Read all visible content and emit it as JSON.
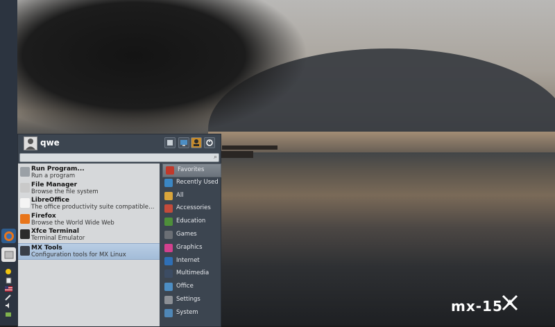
{
  "desktop": {
    "logo_text": "mx-15"
  },
  "left_panel": {
    "apps": [
      {
        "icon": "firefox-icon"
      },
      {
        "icon": "file-manager-icon"
      }
    ],
    "tray": [
      {
        "icon": "updater-icon"
      },
      {
        "icon": "clipboard-icon"
      },
      {
        "icon": "us-flag-icon"
      },
      {
        "icon": "pen-icon"
      },
      {
        "icon": "volume-icon"
      },
      {
        "icon": "network-icon"
      }
    ]
  },
  "menu": {
    "username": "qwe",
    "header_buttons": [
      {
        "icon": "settings-manager-icon"
      },
      {
        "icon": "lock-screen-icon"
      },
      {
        "icon": "switch-user-icon"
      },
      {
        "icon": "logout-icon"
      }
    ],
    "search": {
      "value": "",
      "placeholder": ""
    },
    "apps": [
      {
        "name": "Run Program...",
        "description": "Run a program",
        "icon": "run-icon",
        "color": "#9aa0a6"
      },
      {
        "name": "File Manager",
        "description": "Browse the file system",
        "icon": "file-manager-icon",
        "color": "#c9c9c9"
      },
      {
        "name": "LibreOffice",
        "description": "The office productivity suite compatible to the o...",
        "icon": "libreoffice-icon",
        "color": "#f4f4f4"
      },
      {
        "name": "Firefox",
        "description": "Browse the World Wide Web",
        "icon": "firefox-icon",
        "color": "#e8751a"
      },
      {
        "name": "Xfce Terminal",
        "description": "Terminal Emulator",
        "icon": "terminal-icon",
        "color": "#2b2b2b"
      },
      {
        "name": "MX Tools",
        "description": "Configuration tools for MX Linux",
        "icon": "mx-tools-icon",
        "color": "#3a3f47",
        "selected": true
      }
    ],
    "categories": [
      {
        "label": "Favorites",
        "icon": "favorites-icon",
        "color": "#c0392b",
        "selected": true
      },
      {
        "label": "Recently Used",
        "icon": "recently-used-icon",
        "color": "#3b87c4"
      },
      {
        "label": "All",
        "icon": "all-icon",
        "color": "#d9a53b"
      },
      {
        "label": "Accessories",
        "icon": "accessories-icon",
        "color": "#c44b3b"
      },
      {
        "label": "Education",
        "icon": "education-icon",
        "color": "#4e8f3a"
      },
      {
        "label": "Games",
        "icon": "games-icon",
        "color": "#6b6f75"
      },
      {
        "label": "Graphics",
        "icon": "graphics-icon",
        "color": "#d2418e"
      },
      {
        "label": "Internet",
        "icon": "internet-icon",
        "color": "#2f6fb5"
      },
      {
        "label": "Multimedia",
        "icon": "multimedia-icon",
        "color": "#3c4c63"
      },
      {
        "label": "Office",
        "icon": "office-icon",
        "color": "#4d8ec4"
      },
      {
        "label": "Settings",
        "icon": "settings-icon",
        "color": "#8c9096"
      },
      {
        "label": "System",
        "icon": "system-icon",
        "color": "#4f87b7"
      }
    ]
  }
}
